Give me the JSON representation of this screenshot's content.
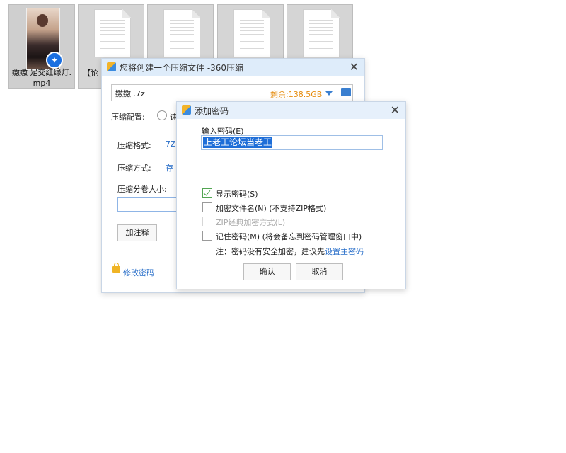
{
  "desktop": {
    "files": [
      {
        "name": "嫐嫐 足交红绿灯.mp4",
        "type": "video"
      },
      {
        "name": "【论坛",
        "type": "document"
      },
      {
        "name": "",
        "type": "document"
      },
      {
        "name": "",
        "type": "document"
      },
      {
        "name": "",
        "type": "document"
      }
    ],
    "video_name_line1": "嫐嫐 足交红绿灯.",
    "video_name_line2": "mp4",
    "doc_name": "【论"
  },
  "compress_dialog": {
    "title": "您将创建一个压缩文件 -360压缩",
    "file_name": "嫐嫐 .7z",
    "free_space": "剩余:138.5GB",
    "config_label": "压缩配置:",
    "config_option_partial": "速",
    "format_label": "压缩格式:",
    "format_value": "7Z",
    "method_label": "压缩方式:",
    "method_value": "存",
    "split_label": "压缩分卷大小:",
    "add_comment_button": "加注释",
    "change_password_link": "修改密码"
  },
  "password_dialog": {
    "title": "添加密码",
    "enter_password_label": "输入密码(E)",
    "password_value": "上老王论坛当老王",
    "show_password": {
      "label": "显示密码(S)",
      "checked": true
    },
    "encrypt_filenames": {
      "label": "加密文件名(N) (不支持ZIP格式)",
      "checked": false
    },
    "zip_classic": {
      "label": "ZIP经典加密方式(L)",
      "checked": false,
      "disabled": true
    },
    "remember_password": {
      "label": "记住密码(M) (将会备忘到密码管理窗口中)",
      "checked": false
    },
    "note_prefix": "注：密码没有安全加密，建议先",
    "note_link": "设置主密码",
    "ok_button": "确认",
    "cancel_button": "取消"
  },
  "colors": {
    "accent_blue": "#2a6fc9",
    "free_space_orange": "#e58b0c",
    "titlebar": "#deecfa"
  }
}
